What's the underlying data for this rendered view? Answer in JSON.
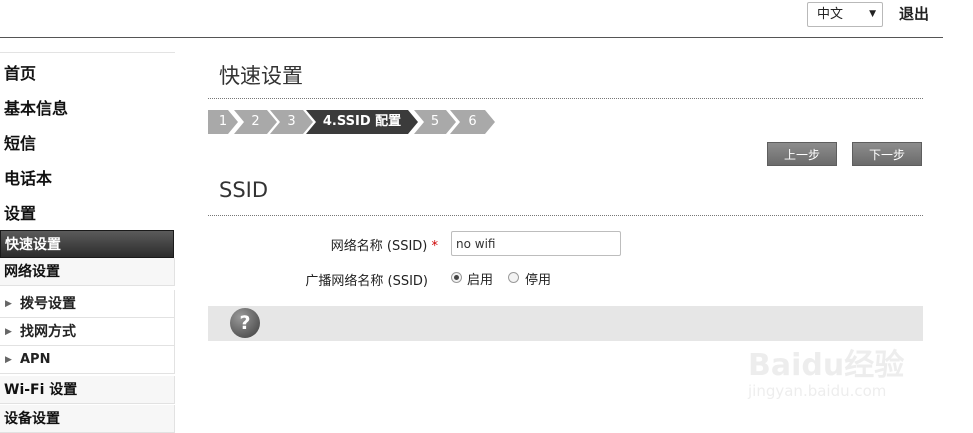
{
  "header": {
    "language": "中文",
    "logout": "退出"
  },
  "sidebar": {
    "main_items": [
      "首页",
      "基本信息",
      "短信",
      "电话本",
      "设置"
    ],
    "active_item": "快速设置",
    "group_network": "网络设置",
    "network_items": [
      "拨号设置",
      "找网方式",
      "APN"
    ],
    "group_wifi": "Wi-Fi 设置",
    "group_device": "设备设置"
  },
  "main": {
    "page_title": "快速设置",
    "steps": [
      "1",
      "2",
      "3",
      "4.SSID 配置",
      "5",
      "6"
    ],
    "active_step_index": 3,
    "prev_button": "上一步",
    "next_button": "下一步",
    "section_title": "SSID",
    "ssid_label": "网络名称 (SSID)",
    "required_mark": "*",
    "ssid_value": "no wifi",
    "broadcast_label": "广播网络名称 (SSID)",
    "broadcast_options": [
      "启用",
      "停用"
    ],
    "broadcast_selected": "启用"
  },
  "watermark": {
    "text": "Baidu经验",
    "url": "jingyan.baidu.com"
  },
  "colors": {
    "active_nav_bg": "#3a3a3a",
    "step_active_bg": "#3b3b3b",
    "step_bg": "#a9a9a9",
    "button_bg": "#7a7a7a",
    "required": "#cc0000"
  }
}
